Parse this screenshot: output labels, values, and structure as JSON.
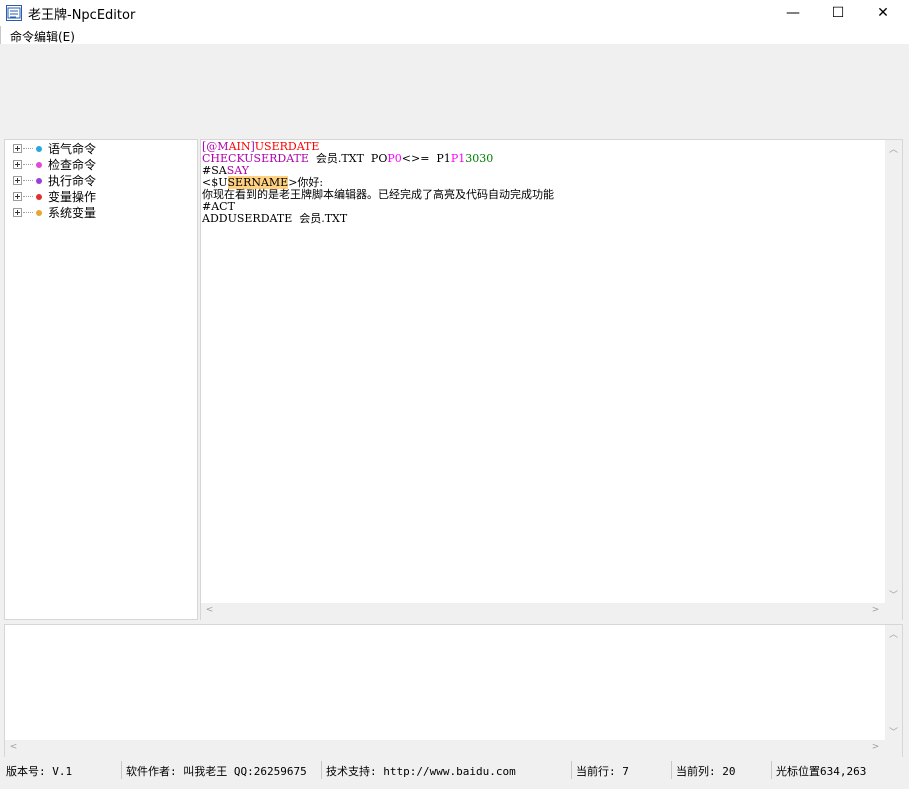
{
  "window": {
    "title": "老王牌-NpcEditor",
    "minimize_glyph": "—",
    "maximize_glyph": "☐",
    "close_glyph": "✕"
  },
  "menu": {
    "items": [
      {
        "label": "命令编辑(E)"
      }
    ]
  },
  "tree": {
    "items": [
      {
        "label": "语气命令",
        "color": "#29a6e0"
      },
      {
        "label": "检查命令",
        "color": "#e04ad6"
      },
      {
        "label": "执行命令",
        "color": "#9b3fd6"
      },
      {
        "label": "变量操作",
        "color": "#e03030"
      },
      {
        "label": "系统变量",
        "color": "#e8a630"
      }
    ]
  },
  "editor": {
    "lines": [
      {
        "segments": [
          {
            "text": "[@M",
            "color": "purple"
          },
          {
            "text": "AIN",
            "color": "red"
          },
          {
            "text": "]",
            "color": "purple"
          },
          {
            "text": "USERDATE",
            "color": "red"
          }
        ]
      },
      {
        "segments": [
          {
            "text": "CHECK",
            "color": "purple"
          },
          {
            "text": "USERDATE",
            "color": "purple"
          },
          {
            "text": "  会员.TXT  PO",
            "color": "black"
          },
          {
            "text": "P0",
            "color": "pink"
          },
          {
            "text": "<>=  P1",
            "color": "black"
          },
          {
            "text": "P1",
            "color": "pink"
          },
          {
            "text": "3030",
            "color": "green"
          }
        ]
      },
      {
        "segments": [
          {
            "text": "#SA",
            "color": "black"
          },
          {
            "text": "SAY",
            "color": "purple"
          }
        ]
      },
      {
        "segments": [
          {
            "text": "<$U",
            "color": "black"
          },
          {
            "text": "SERNAME",
            "color": "highlight"
          },
          {
            "text": ">你好:",
            "color": "black"
          }
        ]
      },
      {
        "segments": [
          {
            "text": "你现在看到的是老王牌脚本编辑器。已经完成了高亮及代码自动完成功能",
            "color": "black"
          }
        ]
      },
      {
        "segments": [
          {
            "text": "#ACT",
            "color": "black"
          }
        ]
      },
      {
        "segments": [
          {
            "text": "ADDUSERDATE  会员.TXT",
            "color": "black"
          }
        ]
      }
    ]
  },
  "status": {
    "version": "版本号: V.1",
    "author": "软件作者: 叫我老王 QQ:26259675",
    "support": "技术支持: http://www.baidu.com",
    "current_row": "当前行: 7",
    "current_col": "当前列: 20",
    "cursor_pos": "光标位置634,263"
  }
}
